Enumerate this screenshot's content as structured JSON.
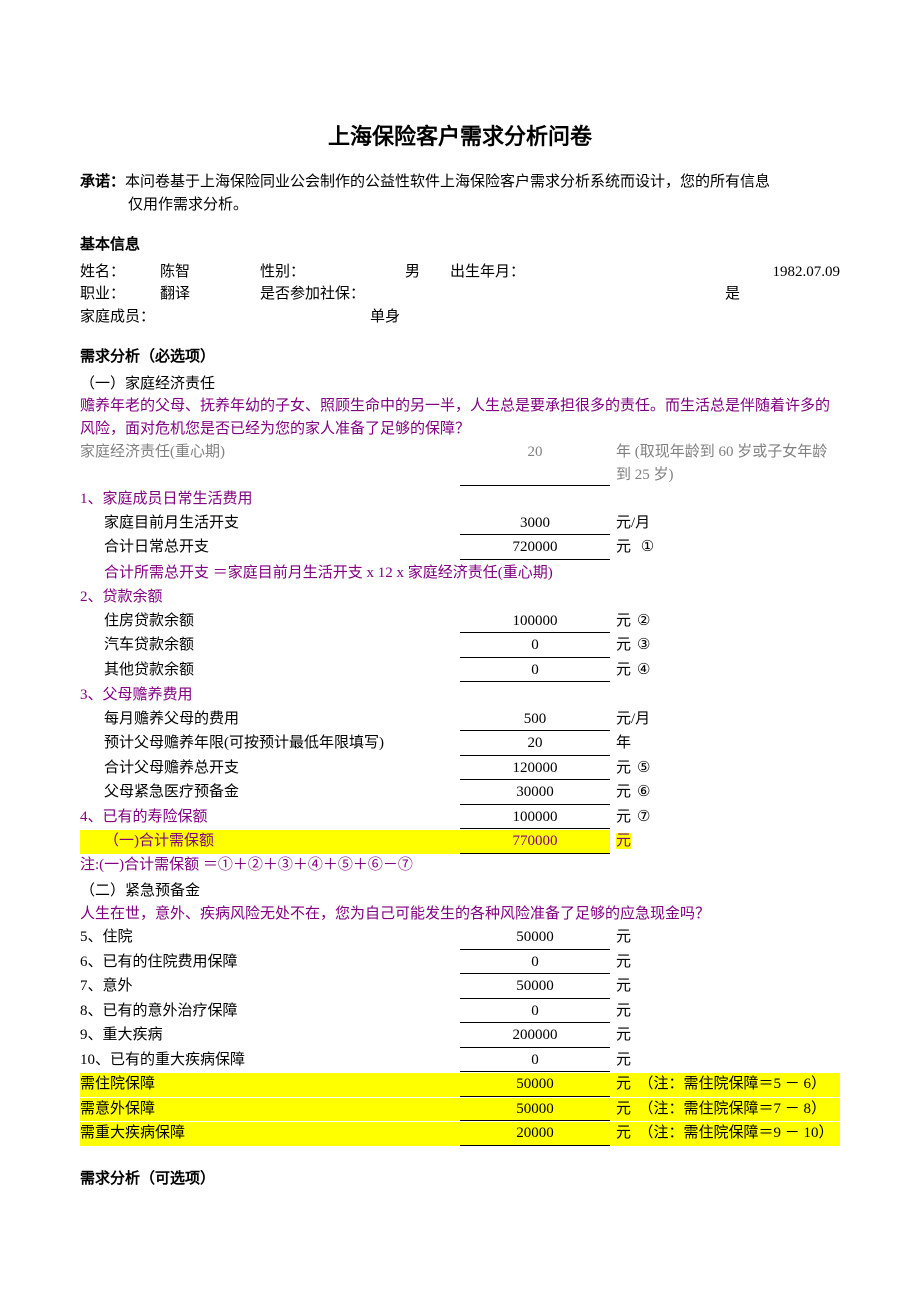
{
  "title": "上海保险客户需求分析问卷",
  "promise": {
    "label": "承诺：",
    "line1": "本问卷基于上海保险同业公会制作的公益性软件上海保险客户需求分析系统而设计，您的所有信息",
    "line2": "仅用作需求分析。"
  },
  "basic": {
    "header": "基本信息",
    "name_label": "姓名：",
    "name_value": "陈智",
    "gender_label": "性别：",
    "gender_value": "男",
    "dob_label": "出生年月：",
    "dob_value": "1982.07.09",
    "occupation_label": "职业：",
    "occupation_value": "翻译",
    "social_insurance_label": "是否参加社保：",
    "social_insurance_value": "是",
    "family_label": "家庭成员：",
    "family_value": "单身"
  },
  "required": {
    "header": "需求分析（必选项）",
    "section1": {
      "title": "（一）家庭经济责任",
      "intro": "赡养年老的父母、抚养年幼的子女、照顾生命中的另一半，人生总是要承担很多的责任。而生活总是伴随着许多的风险，面对危机您是否已经为您的家人准备了足够的保障？",
      "critical_label": "家庭经济责任(重心期)",
      "critical_value": "20",
      "critical_unit": "年 (取现年龄到 60 岁或子女年龄到 25 岁)",
      "item1": {
        "head": "1、家庭成员日常生活费用",
        "r1_label": "家庭目前月生活开支",
        "r1_value": "3000",
        "r1_unit": "元/月",
        "r2_label": "合计日常总开支",
        "r2_value": "720000",
        "r2_unit": "元",
        "r2_mark": "①",
        "formula": "合计所需总开支 ＝家庭目前月生活开支 x 12 x 家庭经济责任(重心期)"
      },
      "item2": {
        "head": "2、贷款余额",
        "r1_label": "住房贷款余额",
        "r1_value": "100000",
        "r1_unit": "元",
        "r1_mark": "②",
        "r2_label": "汽车贷款余额",
        "r2_value": "0",
        "r2_unit": "元",
        "r2_mark": "③",
        "r3_label": "其他贷款余额",
        "r3_value": "0",
        "r3_unit": "元",
        "r3_mark": "④"
      },
      "item3": {
        "head": "3、父母赡养费用",
        "r1_label": "每月赡养父母的费用",
        "r1_value": "500",
        "r1_unit": "元/月",
        "r2_label": "预计父母赡养年限(可按预计最低年限填写)",
        "r2_value": "20",
        "r2_unit": "年",
        "r3_label": "合计父母赡养总开支",
        "r3_value": "120000",
        "r3_unit": "元",
        "r3_mark": "⑤",
        "r4_label": "父母紧急医疗预备金",
        "r4_value": "30000",
        "r4_unit": "元",
        "r4_mark": "⑥"
      },
      "item4": {
        "head": "4、已有的寿险保额",
        "value": "100000",
        "unit": "元",
        "mark": "⑦"
      },
      "total": {
        "label": "（一)合计需保额",
        "value": "770000",
        "unit": "元"
      },
      "note": "注:(一)合计需保额 ＝①＋②＋③＋④＋⑤＋⑥－⑦"
    },
    "section2": {
      "title": "（二）紧急预备金",
      "intro": "人生在世，意外、疾病风险无处不在，您为自己可能发生的各种风险准备了足够的应急现金吗？",
      "r5_label": "5、住院",
      "r5_value": "50000",
      "r5_unit": "元",
      "r6_label": "6、已有的住院费用保障",
      "r6_value": "0",
      "r6_unit": "元",
      "r7_label": "7、意外",
      "r7_value": "50000",
      "r7_unit": "元",
      "r8_label": "8、已有的意外治疗保障",
      "r8_value": "0",
      "r8_unit": "元",
      "r9_label": "9、重大疾病",
      "r9_value": "200000",
      "r9_unit": "元",
      "r10_label": "10、已有的重大疾病保障",
      "r10_value": "0",
      "r10_unit": "元",
      "need_hosp_label": "需住院保障",
      "need_hosp_value": "50000",
      "need_hosp_unit": "元",
      "need_hosp_note": "（注：需住院保障＝5 － 6）",
      "need_acc_label": "需意外保障",
      "need_acc_value": "50000",
      "need_acc_unit": "元",
      "need_acc_note": "（注：需住院保障＝7 － 8）",
      "need_ill_label": "需重大疾病保障",
      "need_ill_value": "20000",
      "need_ill_unit": "元",
      "need_ill_note": "（注：需住院保障＝9 － 10）"
    }
  },
  "optional": {
    "header": "需求分析（可选项）"
  }
}
